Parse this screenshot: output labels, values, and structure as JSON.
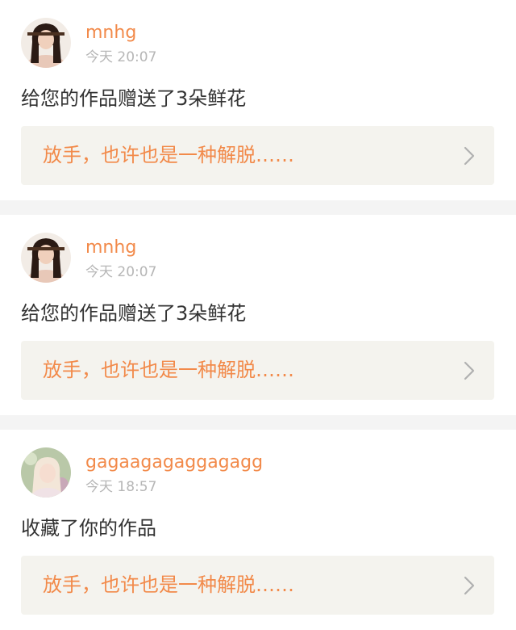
{
  "notifications": [
    {
      "username": "mnhg",
      "time": "今天 20:07",
      "message": "给您的作品赠送了3朵鲜花",
      "work_title": "放手，也许也是一种解脱……",
      "avatar_icon": "user-avatar-icon"
    },
    {
      "username": "mnhg",
      "time": "今天 20:07",
      "message": "给您的作品赠送了3朵鲜花",
      "work_title": "放手，也许也是一种解脱……",
      "avatar_icon": "user-avatar-icon"
    },
    {
      "username": "gagaagagaggagagg",
      "time": "今天 18:57",
      "message": "收藏了你的作品",
      "work_title": "放手，也许也是一种解脱……",
      "avatar_icon": "user-avatar-icon"
    }
  ],
  "colors": {
    "accent": "#f28a4a",
    "timestamp": "#b6b6b6",
    "message_text": "#333333",
    "link_background": "#f4f3ee",
    "page_background": "#f4f4f4",
    "chevron": "#b0b0b0"
  }
}
